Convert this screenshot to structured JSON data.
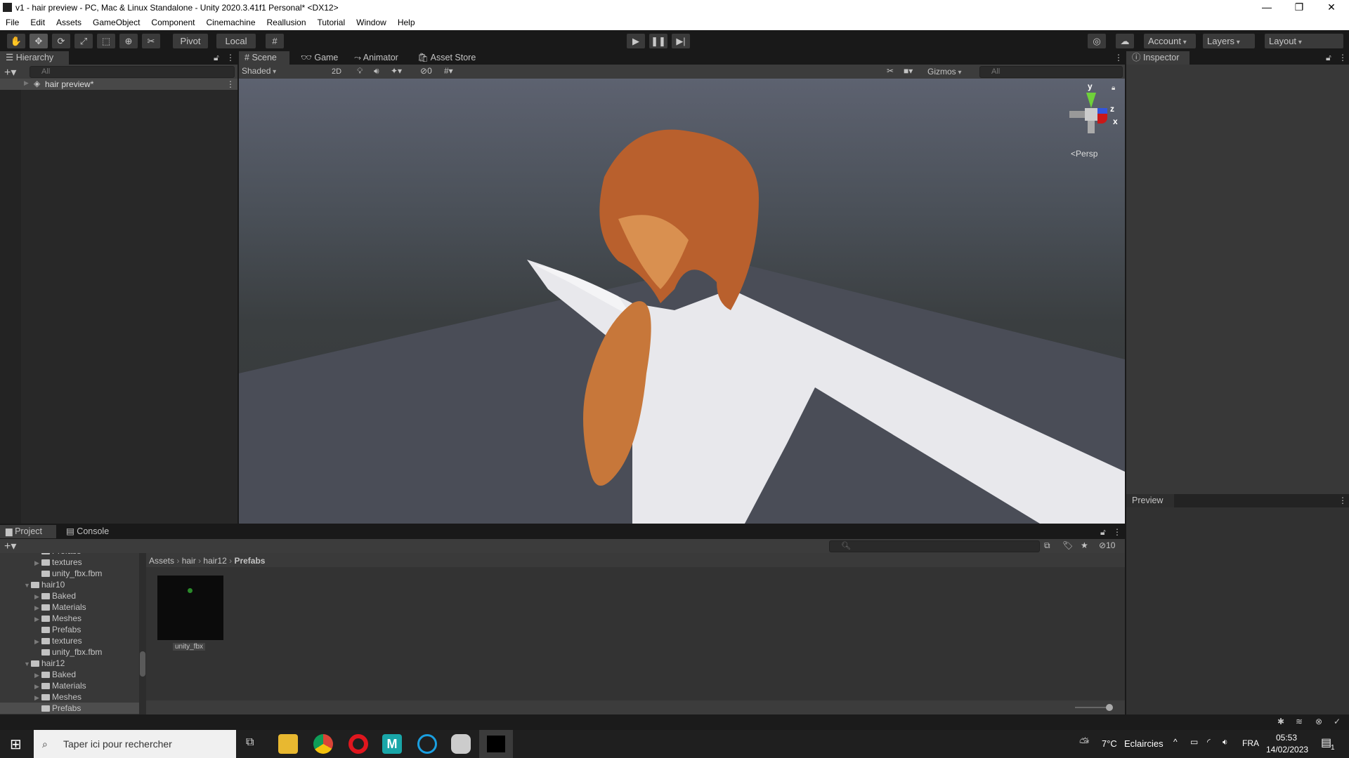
{
  "window": {
    "title": "v1 - hair preview - PC, Mac & Linux Standalone - Unity 2020.3.41f1 Personal* <DX12>",
    "minimize": "—",
    "maximize": "❐",
    "close": "✕"
  },
  "menu": [
    "File",
    "Edit",
    "Assets",
    "GameObject",
    "Component",
    "Cinemachine",
    "Reallusion",
    "Tutorial",
    "Window",
    "Help"
  ],
  "toolbar": {
    "tools": [
      "hand-tool",
      "move-tool",
      "rotate-tool",
      "scale-tool",
      "rect-tool",
      "transform-tool",
      "custom-tool"
    ],
    "pivot": "Pivot",
    "local": "Local",
    "account": "Account",
    "layers": "Layers",
    "layout": "Layout"
  },
  "hierarchy": {
    "tab": "Hierarchy",
    "search_placeholder": "All",
    "scene_item": "hair preview*"
  },
  "scene": {
    "tabs": [
      "Scene",
      "Game",
      "Animator",
      "Asset Store"
    ],
    "shading": "Shaded",
    "mode_2d": "2D",
    "hidden_count": "0",
    "gizmos": "Gizmos",
    "search_placeholder": "All",
    "persp": "Persp",
    "axes": {
      "y": "y",
      "z": "z",
      "x": "x"
    }
  },
  "inspector": {
    "tab": "Inspector",
    "preview": "Preview"
  },
  "project": {
    "tabs": [
      "Project",
      "Console"
    ],
    "breadcrumb": [
      "Assets",
      "hair",
      "hair12",
      "Prefabs"
    ],
    "hidden_count": "10",
    "tree": [
      {
        "label": "Prefabs",
        "depth": 2,
        "arrow": false
      },
      {
        "label": "textures",
        "depth": 2,
        "arrow": true
      },
      {
        "label": "unity_fbx.fbm",
        "depth": 2,
        "arrow": false
      },
      {
        "label": "hair10",
        "depth": 1,
        "arrow": true,
        "open": true
      },
      {
        "label": "Baked",
        "depth": 2,
        "arrow": true
      },
      {
        "label": "Materials",
        "depth": 2,
        "arrow": true
      },
      {
        "label": "Meshes",
        "depth": 2,
        "arrow": true
      },
      {
        "label": "Prefabs",
        "depth": 2,
        "arrow": false
      },
      {
        "label": "textures",
        "depth": 2,
        "arrow": true
      },
      {
        "label": "unity_fbx.fbm",
        "depth": 2,
        "arrow": false
      },
      {
        "label": "hair12",
        "depth": 1,
        "arrow": true,
        "open": true
      },
      {
        "label": "Baked",
        "depth": 2,
        "arrow": true
      },
      {
        "label": "Materials",
        "depth": 2,
        "arrow": true
      },
      {
        "label": "Meshes",
        "depth": 2,
        "arrow": true
      },
      {
        "label": "Prefabs",
        "depth": 2,
        "arrow": false,
        "selected": true
      }
    ],
    "assets": [
      {
        "label": "unity_fbx"
      }
    ]
  },
  "taskbar": {
    "search_placeholder": "Taper ici pour rechercher",
    "weather_temp": "7°C",
    "weather_text": "Eclaircies",
    "lang": "FRA",
    "time": "05:53",
    "date": "14/02/2023",
    "notifications": "1"
  },
  "colors": {
    "accent_select": "#2c5d87",
    "panel": "#383838",
    "scene_ground": "#4a4d57",
    "hair": "#c2622c"
  }
}
